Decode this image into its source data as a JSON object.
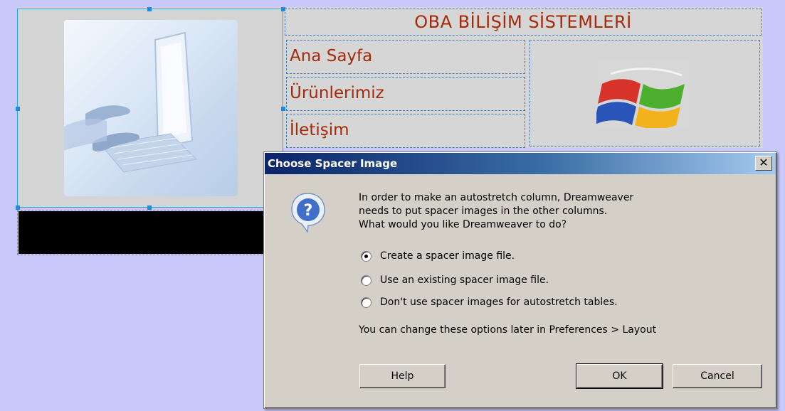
{
  "page": {
    "site_title": "OBA BİLİŞİM SİSTEMLERİ",
    "nav": [
      "Ana Sayfa",
      "Ürünlerimiz",
      "İletişim"
    ],
    "background_color": "#c8c8fb",
    "accent_text_color": "#a52a0a"
  },
  "dialog": {
    "title": "Choose Spacer Image",
    "close_glyph": "✕",
    "icon": "question-icon",
    "message": [
      "In order to make an autostretch column, Dreamweaver",
      "needs to put spacer images in the other columns.",
      "What would you like Dreamweaver to do?"
    ],
    "options": [
      {
        "label": "Create a spacer image file.",
        "selected": true
      },
      {
        "label": "Use an existing spacer image file.",
        "selected": false
      },
      {
        "label": "Don't use spacer images for autostretch tables.",
        "selected": false
      }
    ],
    "note": "You can change these options later in Preferences > Layout",
    "buttons": {
      "help": "Help",
      "ok": "OK",
      "cancel": "Cancel"
    }
  }
}
